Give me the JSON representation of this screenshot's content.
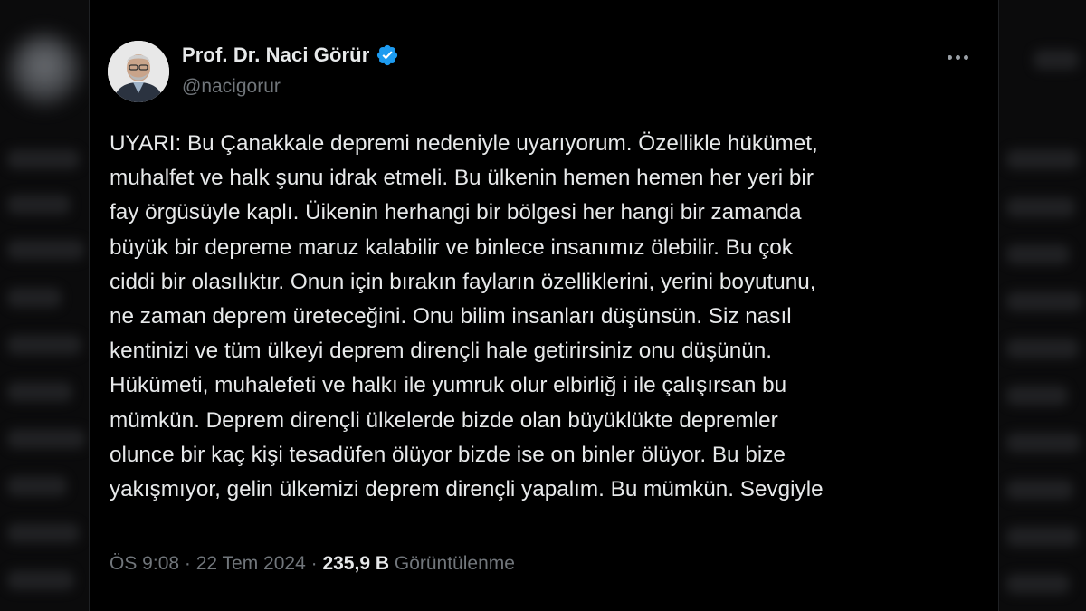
{
  "author": {
    "display_name": "Prof. Dr. Naci Görür",
    "handle": "@nacigorur",
    "verified_icon": "verified-badge-icon",
    "badge_color": "#1d9bf0"
  },
  "tweet": {
    "text": "UYARI: Bu Çanakkale depremi nedeniyle uyarıyorum. Özellikle hükümet,\nmuhalfet ve halk şunu idrak etmeli.  Bu ülkenin hemen hemen her yeri bir\nfay örgüsüyle kaplı. Üikenin herhangi bir bölgesi her hangi bir zamanda\nbüyük bir depreme maruz kalabilir  ve binlece insanımız ölebilir. Bu çok\nciddi bir olasılıktır. Onun için bırakın fayların özelliklerini, yerini boyutunu,\nne zaman deprem üreteceğini. Onu bilim insanları düşünsün. Siz nasıl\nkentinizi ve tüm ülkeyi deprem dirençli hale getirirsiniz onu düşünün.\nHükümeti, muhalefeti ve halkı ile yumruk olur elbirliğ i ile çalışırsan bu\nmümkün. Deprem dirençli ülkelerde bizde olan büyüklükte depremler\nolunce bir kaç kişi tesadüfen ölüyor bizde ise on binler ölüyor. Bu bize\nyakışmıyor, gelin ülkemizi deprem dirençli yapalım. Bu mümkün. Sevgiyle",
    "time": "ÖS 9:08",
    "separator": " · ",
    "date": "22 Tem 2024",
    "views_count": "235,9 B",
    "views_label": "Görüntülenme"
  },
  "menu": {
    "icon": "more-options-icon"
  },
  "colors": {
    "background": "#000000",
    "text": "#e7e9ea",
    "secondary": "#71767b"
  }
}
